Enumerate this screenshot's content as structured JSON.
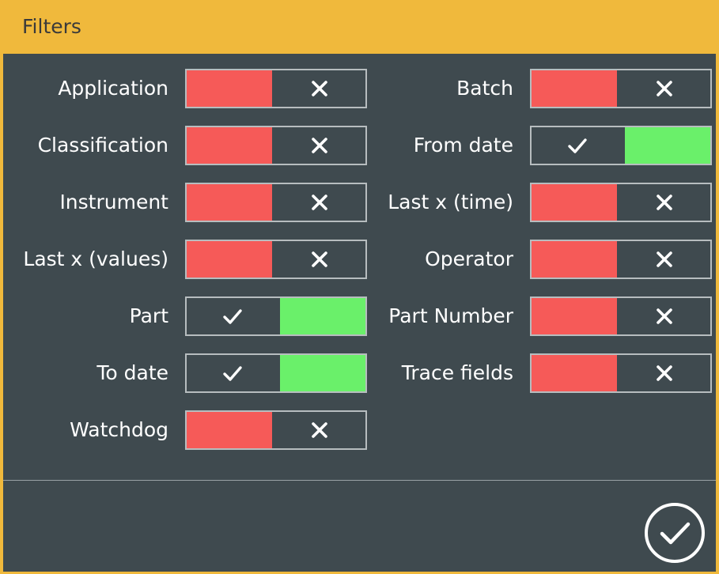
{
  "dialog": {
    "title": "Filters",
    "accent_color": "#f0b93c",
    "background_color": "#3f4a4f",
    "off_color": "#f65a58",
    "on_color": "#6af06a"
  },
  "filters_left": [
    {
      "label": "Application",
      "enabled": false
    },
    {
      "label": "Classification",
      "enabled": false
    },
    {
      "label": "Instrument",
      "enabled": false
    },
    {
      "label": "Last x (values)",
      "enabled": false
    },
    {
      "label": "Part",
      "enabled": true
    },
    {
      "label": "To date",
      "enabled": true
    },
    {
      "label": "Watchdog",
      "enabled": false
    }
  ],
  "filters_right": [
    {
      "label": "Batch",
      "enabled": false
    },
    {
      "label": "From date",
      "enabled": true
    },
    {
      "label": "Last x (time)",
      "enabled": false
    },
    {
      "label": "Operator",
      "enabled": false
    },
    {
      "label": "Part Number",
      "enabled": false
    },
    {
      "label": "Trace fields",
      "enabled": false
    }
  ],
  "footer": {
    "confirm_icon": "circle-check-icon"
  }
}
